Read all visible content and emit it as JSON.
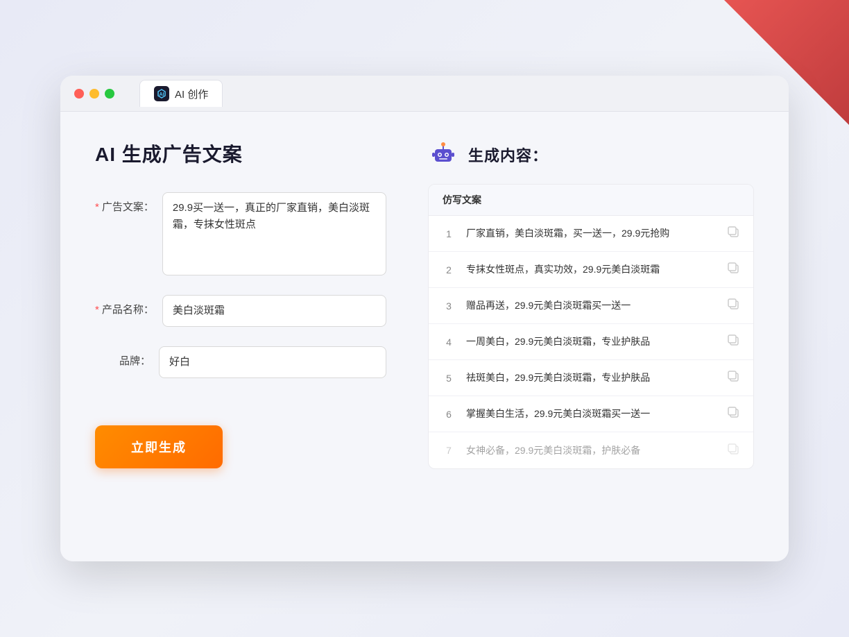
{
  "browser": {
    "tab_title": "AI 创作",
    "traffic_lights": [
      "red",
      "yellow",
      "green"
    ]
  },
  "left_panel": {
    "page_title": "AI 生成广告文案",
    "form": {
      "ad_copy_label": "广告文案：",
      "ad_copy_required": "*",
      "ad_copy_value": "29.9买一送一，真正的厂家直销，美白淡斑霜，专抹女性斑点",
      "product_name_label": "产品名称：",
      "product_name_required": "*",
      "product_name_value": "美白淡斑霜",
      "brand_label": "品牌：",
      "brand_value": "好白"
    },
    "generate_button_label": "立即生成"
  },
  "right_panel": {
    "result_title": "生成内容：",
    "table_header": "仿写文案",
    "results": [
      {
        "number": "1",
        "text": "厂家直销，美白淡斑霜，买一送一，29.9元抢购",
        "dimmed": false
      },
      {
        "number": "2",
        "text": "专抹女性斑点，真实功效，29.9元美白淡斑霜",
        "dimmed": false
      },
      {
        "number": "3",
        "text": "赠品再送，29.9元美白淡斑霜买一送一",
        "dimmed": false
      },
      {
        "number": "4",
        "text": "一周美白，29.9元美白淡斑霜，专业护肤品",
        "dimmed": false
      },
      {
        "number": "5",
        "text": "祛斑美白，29.9元美白淡斑霜，专业护肤品",
        "dimmed": false
      },
      {
        "number": "6",
        "text": "掌握美白生活，29.9元美白淡斑霜买一送一",
        "dimmed": false
      },
      {
        "number": "7",
        "text": "女神必备，29.9元美白淡斑霜，护肤必备",
        "dimmed": true
      }
    ]
  },
  "colors": {
    "accent_orange": "#ff6b00",
    "required_red": "#ff4d4f",
    "ai_purple": "#5b4fcf"
  }
}
